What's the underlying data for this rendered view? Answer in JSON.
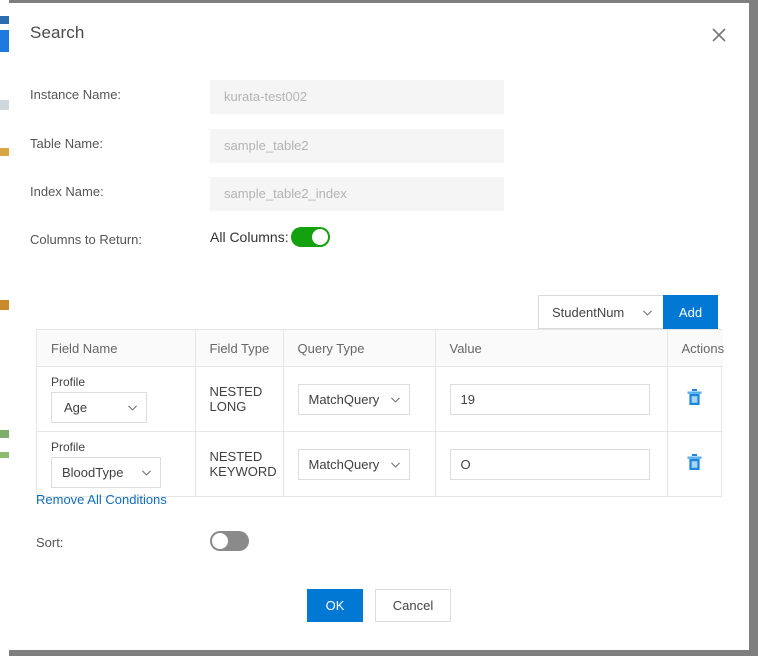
{
  "dialog": {
    "title": "Search",
    "close_icon": "close-icon"
  },
  "form": {
    "fields": [
      {
        "label": "Instance Name:",
        "value": "kurata-test002"
      },
      {
        "label": "Table Name:",
        "value": "sample_table2"
      },
      {
        "label": "Index Name:",
        "value": "sample_table2_index"
      }
    ],
    "columns_to_return": {
      "label": "Columns to Return:",
      "all_columns_label": "All Columns:",
      "all_columns_on": true
    }
  },
  "add_condition": {
    "selected_field": "StudentNum",
    "chevron_icon": "chevron-down-icon",
    "add_label": "Add"
  },
  "conditions_table": {
    "headers": [
      "Field Name",
      "Field Type",
      "Query Type",
      "Value",
      "Actions"
    ],
    "rows": [
      {
        "parent_field": "Profile",
        "field_name": "Age",
        "field_type": "NESTED LONG",
        "query_type": "MatchQuery",
        "value": "19",
        "delete_icon": "trash-icon"
      },
      {
        "parent_field": "Profile",
        "field_name": "BloodType",
        "field_type": "NESTED KEYWORD",
        "query_type": "MatchQuery",
        "value": "O",
        "delete_icon": "trash-icon"
      }
    ]
  },
  "remove_all_label": "Remove All Conditions",
  "sort": {
    "label": "Sort:",
    "enabled": false
  },
  "footer": {
    "ok_label": "OK",
    "cancel_label": "Cancel"
  },
  "colors": {
    "accent_blue": "#0078d4",
    "link_blue": "#0f6cbd",
    "toggle_on_green": "#13a10e",
    "toggle_off_gray": "#8a8a8a",
    "trash_blue": "#1a86e0"
  }
}
